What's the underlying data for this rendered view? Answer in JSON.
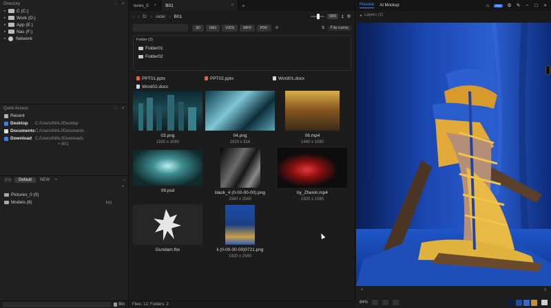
{
  "left": {
    "directory": {
      "title": "Directory",
      "items": [
        {
          "label": "C (C:)",
          "icon": "disk-icon"
        },
        {
          "label": "Work (D:)",
          "icon": "disk-icon"
        },
        {
          "label": "App (E:)",
          "icon": "disk-icon"
        },
        {
          "label": "Nas (F:)",
          "icon": "disk-icon"
        },
        {
          "label": "Network",
          "icon": "globe-icon"
        }
      ]
    },
    "quick_access": {
      "title": "Quick Access",
      "items": [
        {
          "name": "Recent",
          "path": "",
          "color": "#b0b0b0"
        },
        {
          "name": "Desktop",
          "path": "C:/Users/MALI/Desktop",
          "color": "#3c7fe0"
        },
        {
          "name": "Documents",
          "path": "C:/Users/MALI/Documents",
          "color": "#dddddd"
        },
        {
          "name": "Download",
          "path": "C:/Users/MALI/Downloads",
          "color": "#3c7fe0"
        }
      ],
      "add_label": "+ B01"
    },
    "library": {
      "tabs": [
        "Default",
        "NEW"
      ],
      "items": [
        {
          "label": "Pictures_0 (0)"
        },
        {
          "label": "Models (8)"
        }
      ]
    },
    "bin_label": "Bin"
  },
  "center": {
    "tabs": [
      {
        "label": "tures_0"
      },
      {
        "label": "B01"
      }
    ],
    "path": {
      "root": "D:",
      "mid": "older",
      "current": "B01"
    },
    "zoom_badge": "OFF",
    "zoom_value": "1",
    "filter_types": [
      "3D",
      "IMG",
      "VIDS",
      "MP3",
      "PDF"
    ],
    "sort_label": "File name",
    "folders_title": "Folder (2)",
    "folders": [
      "Folder01",
      "Folder02"
    ],
    "docs": [
      {
        "label": "PPT01.pptx",
        "color": "#e0663a"
      },
      {
        "label": "PPT02.pptx",
        "color": "#e0663a"
      },
      {
        "label": "Word01.docx",
        "color": "#d9d9d9"
      },
      {
        "label": "Word02.docx",
        "color": "#d9d9d9"
      }
    ],
    "media": [
      {
        "name": "03.png",
        "dims": "1920 x 1080"
      },
      {
        "name": "04.png",
        "dims": "1920 x 816"
      },
      {
        "name": "08.mp4",
        "dims": "1440 x 1080"
      },
      {
        "name": "09.psd",
        "dims": ""
      },
      {
        "name": "black_4 (0-00-00-00).png",
        "dims": "2560 x 2560"
      },
      {
        "name": "by_Zhenin.mp4",
        "dims": "1920 x 1080"
      },
      {
        "name": "Gundam.fbx",
        "dims": ""
      },
      {
        "name": "li (0-00-00-00)0721.png",
        "dims": "1920 x 2560"
      }
    ],
    "status": "Files: 12; Folders: 2"
  },
  "right": {
    "tabs": [
      "Preview",
      "AI Mockup"
    ],
    "pro_badge": "PRO",
    "layers_label": "Layers (1)",
    "zoom": "84%",
    "swatches": [
      "#0b1e44",
      "#1d4fa8",
      "#3a66c4",
      "#c78d3a"
    ]
  }
}
